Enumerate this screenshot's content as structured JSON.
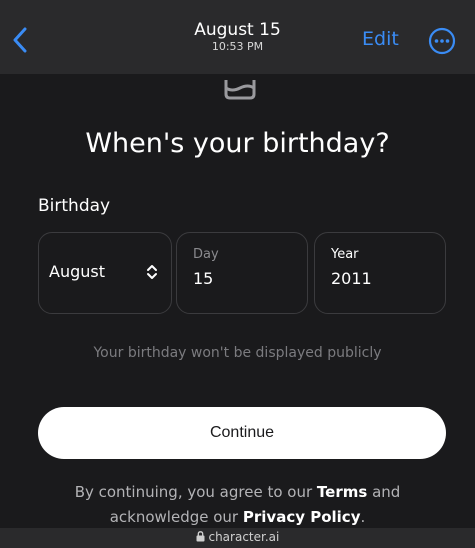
{
  "header": {
    "title": "August 15",
    "subtitle": "10:53 PM",
    "edit_label": "Edit",
    "accent": "#3a8cf5"
  },
  "main": {
    "heading": "When's your birthday?",
    "field_label": "Birthday",
    "month": {
      "value": "August"
    },
    "day": {
      "label": "Day",
      "value": "15"
    },
    "year": {
      "label": "Year",
      "value": "2011"
    },
    "notice": "Your birthday won't be displayed publicly",
    "continue_label": "Continue",
    "legal": {
      "prefix": "By continuing, you agree to our",
      "terms": "Terms",
      "and": "and",
      "ack": "acknowledge our",
      "privacy": "Privacy Policy",
      "end": "."
    }
  },
  "footer": {
    "url": "character.ai"
  },
  "icons": [
    "back-chevron-icon",
    "more-circle-icon",
    "cake-icon",
    "updown-chevron-icon",
    "lock-icon"
  ]
}
